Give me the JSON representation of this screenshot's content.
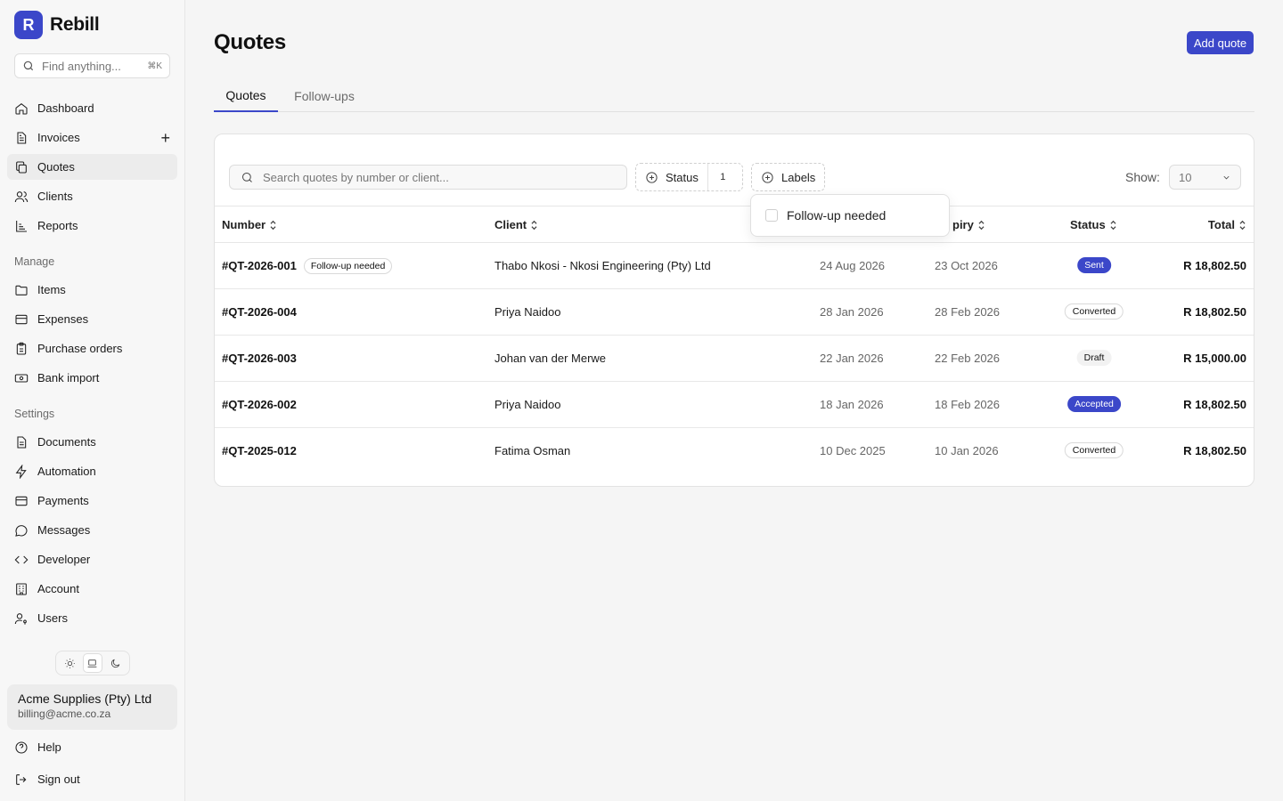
{
  "brand": {
    "logo_letter": "R",
    "name": "Rebill"
  },
  "search_global": {
    "placeholder": "Find anything...",
    "shortcut": "⌘K"
  },
  "nav_main": [
    {
      "label": "Dashboard",
      "icon": "home-icon"
    },
    {
      "label": "Invoices",
      "icon": "file-icon",
      "action": "+"
    },
    {
      "label": "Quotes",
      "icon": "copy-icon",
      "active": true
    },
    {
      "label": "Clients",
      "icon": "users-icon"
    },
    {
      "label": "Reports",
      "icon": "chart-icon"
    }
  ],
  "sections": {
    "manage": "Manage",
    "settings": "Settings"
  },
  "nav_manage": [
    {
      "label": "Items",
      "icon": "folder-icon"
    },
    {
      "label": "Expenses",
      "icon": "card-icon"
    },
    {
      "label": "Purchase orders",
      "icon": "clipboard-icon"
    },
    {
      "label": "Bank import",
      "icon": "banknote-icon"
    }
  ],
  "nav_settings": [
    {
      "label": "Documents",
      "icon": "file-icon"
    },
    {
      "label": "Automation",
      "icon": "bolt-icon"
    },
    {
      "label": "Payments",
      "icon": "card-icon"
    },
    {
      "label": "Messages",
      "icon": "message-icon"
    },
    {
      "label": "Developer",
      "icon": "code-icon"
    },
    {
      "label": "Account",
      "icon": "building-icon"
    },
    {
      "label": "Users",
      "icon": "user-key-icon"
    }
  ],
  "theme": {
    "selected": "system"
  },
  "account": {
    "name": "Acme Supplies (Pty) Ltd",
    "email": "billing@acme.co.za"
  },
  "footer": {
    "help": "Help",
    "sign_out": "Sign out"
  },
  "page": {
    "title": "Quotes",
    "add_button": "Add quote",
    "tabs": [
      {
        "label": "Quotes",
        "active": true
      },
      {
        "label": "Follow-ups",
        "active": false
      }
    ]
  },
  "filters": {
    "search_placeholder": "Search quotes by number or client...",
    "status_label": "Status",
    "status_count": "1",
    "labels_label": "Labels",
    "show_label": "Show:",
    "show_value": "10"
  },
  "popover": {
    "option": "Follow-up needed"
  },
  "table": {
    "columns": {
      "number": "Number",
      "client": "Client",
      "issued": "",
      "expiry": "piry",
      "status": "Status",
      "total": "Total"
    },
    "rows": [
      {
        "number": "#QT-2026-001",
        "label": "Follow-up needed",
        "client": "Thabo Nkosi - Nkosi Engineering (Pty) Ltd",
        "issued": "24 Aug 2026",
        "expiry": "23 Oct 2026",
        "status": "Sent",
        "total": "R 18,802.50"
      },
      {
        "number": "#QT-2026-004",
        "label": "",
        "client": "Priya Naidoo",
        "issued": "28 Jan 2026",
        "expiry": "28 Feb 2026",
        "status": "Converted",
        "total": "R 18,802.50"
      },
      {
        "number": "#QT-2026-003",
        "label": "",
        "client": "Johan van der Merwe",
        "issued": "22 Jan 2026",
        "expiry": "22 Feb 2026",
        "status": "Draft",
        "total": "R 15,000.00"
      },
      {
        "number": "#QT-2026-002",
        "label": "",
        "client": "Priya Naidoo",
        "issued": "18 Jan 2026",
        "expiry": "18 Feb 2026",
        "status": "Accepted",
        "total": "R 18,802.50"
      },
      {
        "number": "#QT-2025-012",
        "label": "",
        "client": "Fatima Osman",
        "issued": "10 Dec 2025",
        "expiry": "10 Jan 2026",
        "status": "Converted",
        "total": "R 18,802.50"
      }
    ]
  },
  "colors": {
    "accent": "#3b47c9"
  }
}
